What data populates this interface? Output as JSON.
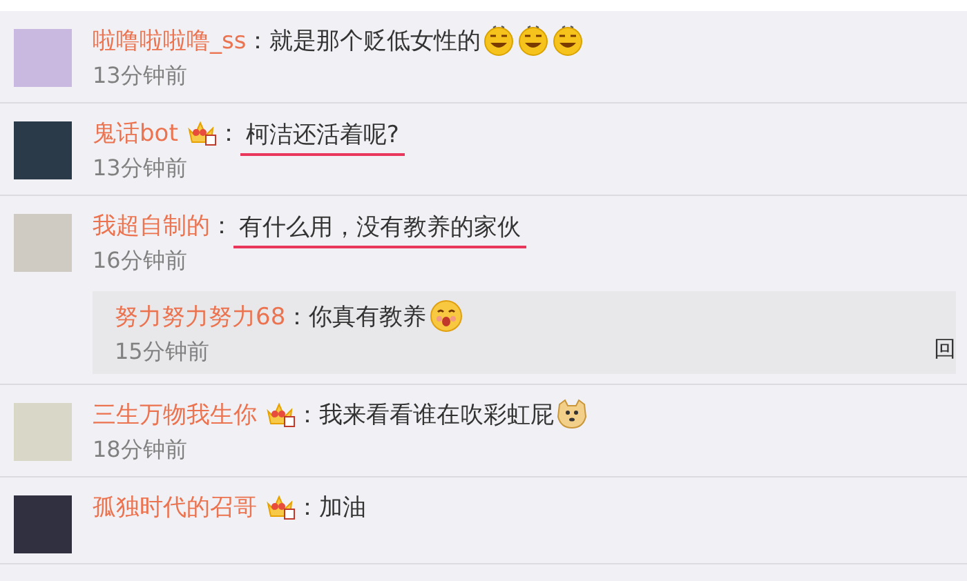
{
  "comments": [
    {
      "user": "啦噜啦啦噜_ss",
      "badge": false,
      "separator": "：",
      "text": "就是那个贬低女性的",
      "underlined": false,
      "emojis": [
        {
          "kind": "grin"
        },
        {
          "kind": "grin"
        },
        {
          "kind": "grin"
        }
      ],
      "time": "13分钟前"
    },
    {
      "user": "鬼话bot",
      "badge": true,
      "separator": "：",
      "text": "柯洁还活着呢?",
      "underlined": true,
      "time": "13分钟前"
    },
    {
      "user": "我超自制的",
      "badge": false,
      "separator": "：",
      "text": "有什么用，没有教养的家伙",
      "underlined": true,
      "time": "16分钟前",
      "replies": [
        {
          "user": "努力努力努力68",
          "separator": "：",
          "text": "你真有教养",
          "emojis": [
            {
              "kind": "blush"
            }
          ],
          "time": "15分钟前",
          "action": "回"
        }
      ]
    },
    {
      "user": "三生万物我生你",
      "badge": true,
      "separator": "：",
      "text": "我来看看谁在吹彩虹屁",
      "underlined": false,
      "emojis": [
        {
          "kind": "doge"
        }
      ],
      "time": "18分钟前"
    },
    {
      "user": "孤独时代的召哥",
      "badge": true,
      "separator": "：",
      "text": "加油",
      "underlined": false
    }
  ]
}
